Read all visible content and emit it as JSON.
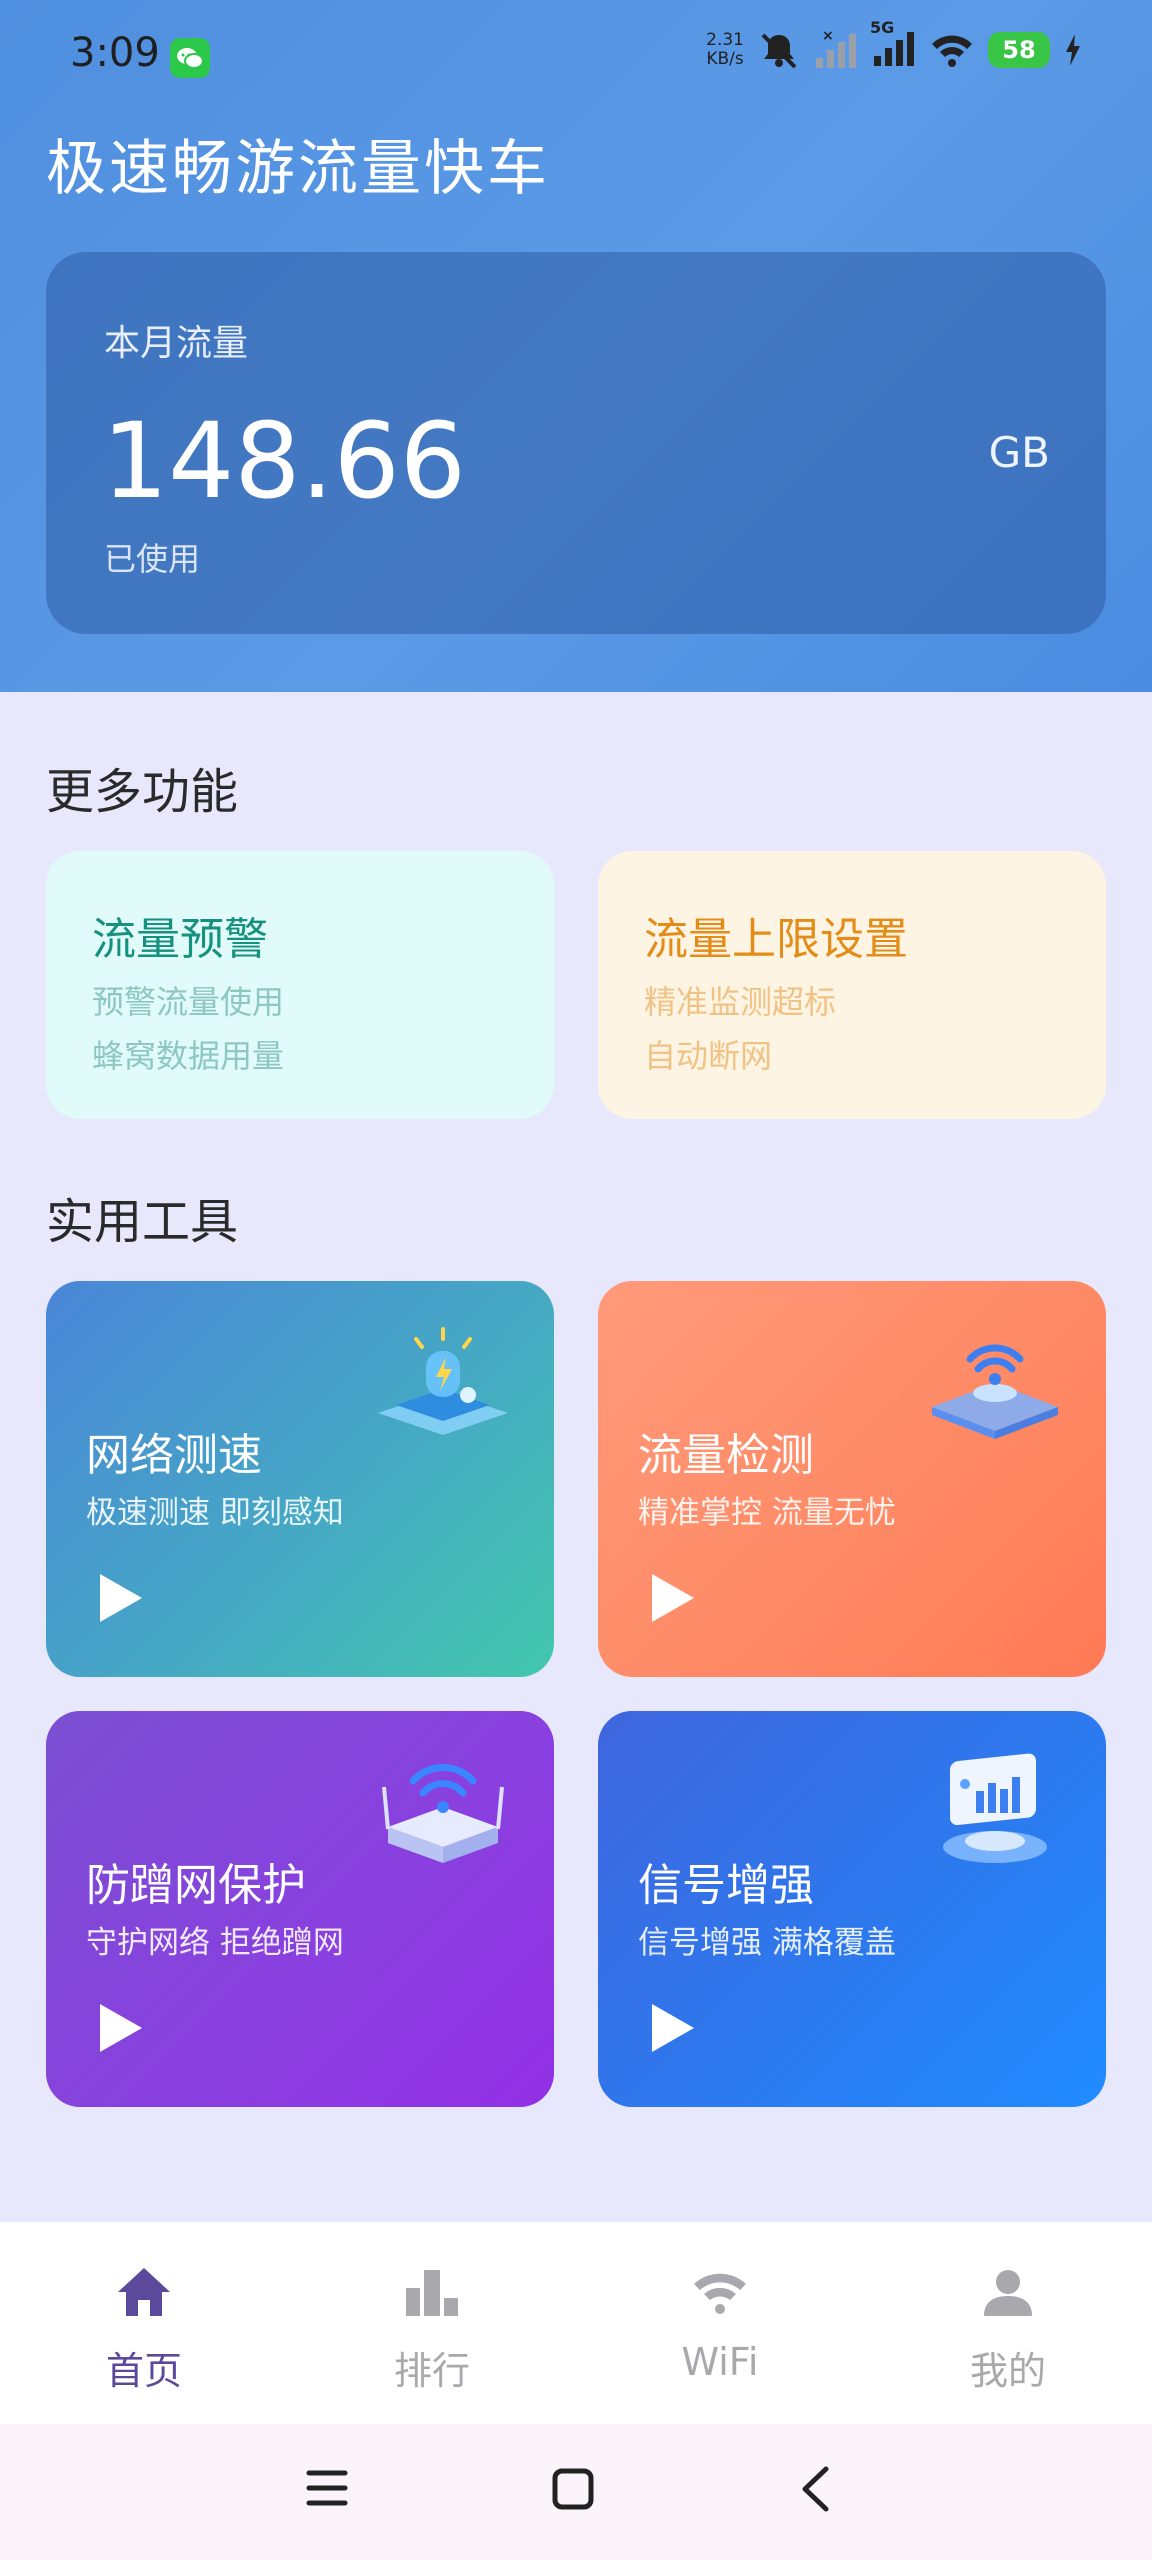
{
  "status_bar": {
    "time": "3:09",
    "net_speed_value": "2.31",
    "net_speed_unit": "KB/s",
    "signal_label": "5G",
    "battery": "58"
  },
  "app_title": "极速畅游流量快车",
  "usage": {
    "label": "本月流量",
    "value": "148.66",
    "unit": "GB",
    "sub": "已使用"
  },
  "more_features": {
    "title": "更多功能",
    "cards": [
      {
        "title": "流量预警",
        "line1": "预警流量使用",
        "line2": "蜂窝数据用量",
        "color": "#16917e"
      },
      {
        "title": "流量上限设置",
        "line1": "精准监测超标",
        "line2": "自动断网",
        "color": "#e38d18"
      }
    ]
  },
  "tools": {
    "title": "实用工具",
    "cards": [
      {
        "title": "网络测速",
        "sub": "极速测速 即刻感知"
      },
      {
        "title": "流量检测",
        "sub": "精准掌控 流量无忧"
      },
      {
        "title": "防蹭网保护",
        "sub": "守护网络 拒绝蹭网"
      },
      {
        "title": "信号增强",
        "sub": "信号增强 满格覆盖"
      }
    ]
  },
  "tabs": [
    {
      "label": "首页",
      "icon": "home-icon",
      "active": true
    },
    {
      "label": "排行",
      "icon": "ranking-icon",
      "active": false
    },
    {
      "label": "WiFi",
      "icon": "wifi-icon",
      "active": false
    },
    {
      "label": "我的",
      "icon": "user-icon",
      "active": false
    }
  ],
  "colors": {
    "accent": "#5b4a9c",
    "inactive": "#a8a8ad"
  }
}
